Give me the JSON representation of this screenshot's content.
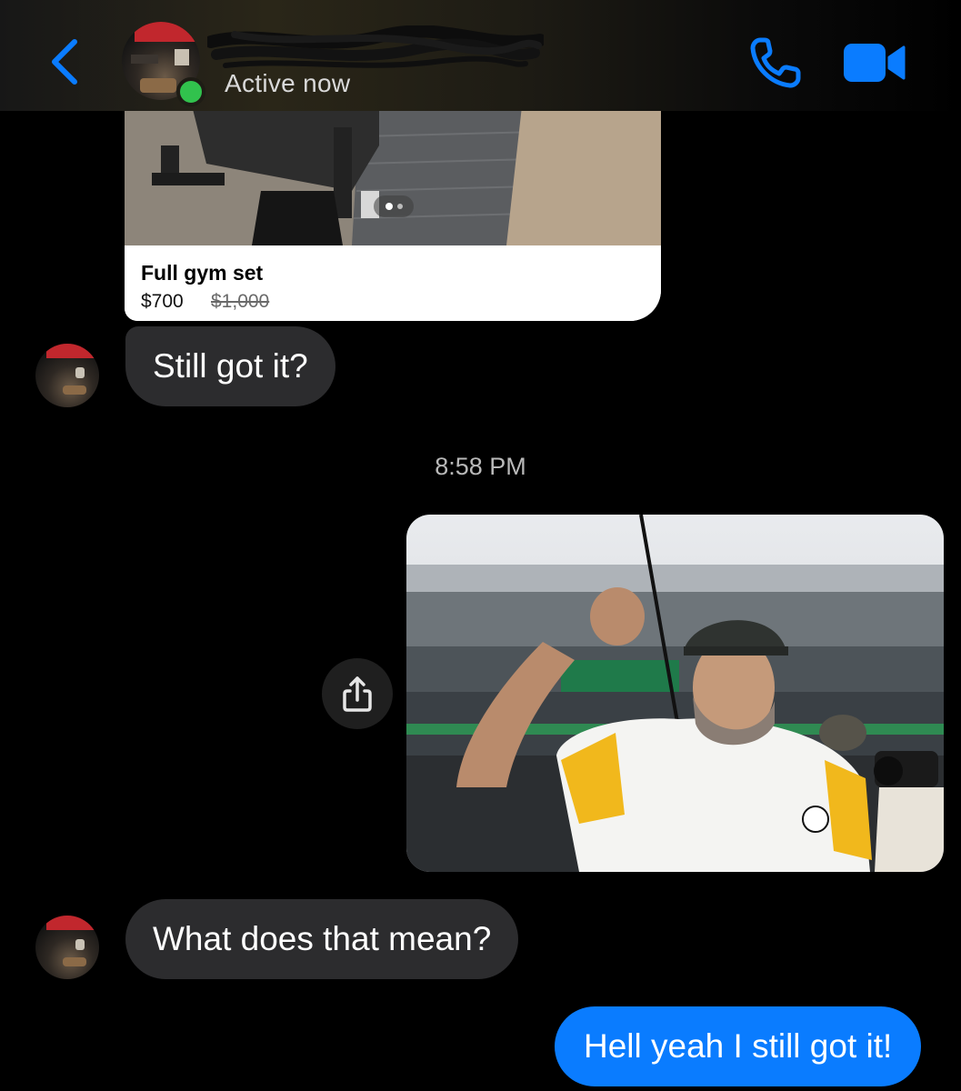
{
  "header": {
    "status": "Active now",
    "accent_color": "#0a7cff",
    "online_color": "#31c24d",
    "back_icon": "chevron-left-icon",
    "call_icon": "phone-icon",
    "video_icon": "video-camera-icon"
  },
  "listing": {
    "title": "Full gym set",
    "price": "$700",
    "original_price": "$1,000"
  },
  "messages": {
    "m1": "Still got it?",
    "time": "8:58 PM",
    "share_icon": "share-icon",
    "m2": "What does that mean?",
    "m3": "Hell yeah I still got it!"
  },
  "colors": {
    "incoming_bubble": "#2c2c2e",
    "outgoing_bubble": "#0a7cff",
    "background": "#000000"
  }
}
